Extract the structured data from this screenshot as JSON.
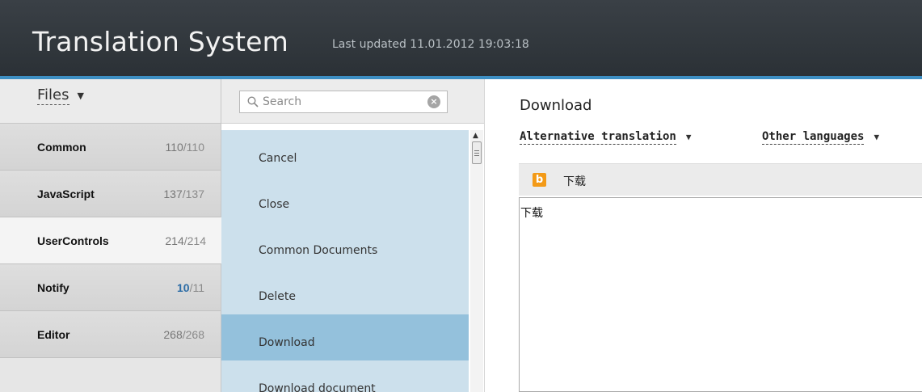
{
  "header": {
    "title": "Translation System",
    "last_updated": "Last updated 11.01.2012 19:03:18"
  },
  "colors": {
    "header_bg": "#2e3439",
    "accent": "#3d8fc3",
    "key_list_bg": "#cce0ec",
    "key_selected_bg": "#94c1dc",
    "incomplete_count": "#2d6da6",
    "bing_orange": "#f39a17"
  },
  "files": {
    "dropdown_label": "Files",
    "caret": "▼",
    "items": [
      {
        "name": "Common",
        "done": "110",
        "total": "/110",
        "incomplete": false
      },
      {
        "name": "JavaScript",
        "done": "137",
        "total": "/137",
        "incomplete": false
      },
      {
        "name": "UserControls",
        "done": "214",
        "total": "/214",
        "incomplete": false,
        "active": true
      },
      {
        "name": "Notify",
        "done": "10",
        "total": "/11",
        "incomplete": true
      },
      {
        "name": "Editor",
        "done": "268",
        "total": "/268",
        "incomplete": false
      }
    ]
  },
  "keys": {
    "search_placeholder": "Search",
    "search_icon": "magnifier-icon",
    "clear_icon": "clear-icon",
    "items": [
      {
        "label": "Cancel"
      },
      {
        "label": "Close"
      },
      {
        "label": "Common Documents"
      },
      {
        "label": "Delete"
      },
      {
        "label": "Download",
        "selected": true
      },
      {
        "label": "Download document"
      }
    ]
  },
  "editor": {
    "title": "Download",
    "alternative_label": "Alternative translation",
    "other_languages_label": "Other languages",
    "caret": "▼",
    "suggestion_icon_letter": "b",
    "suggestion_text": "下载",
    "translation_value": "下载"
  }
}
